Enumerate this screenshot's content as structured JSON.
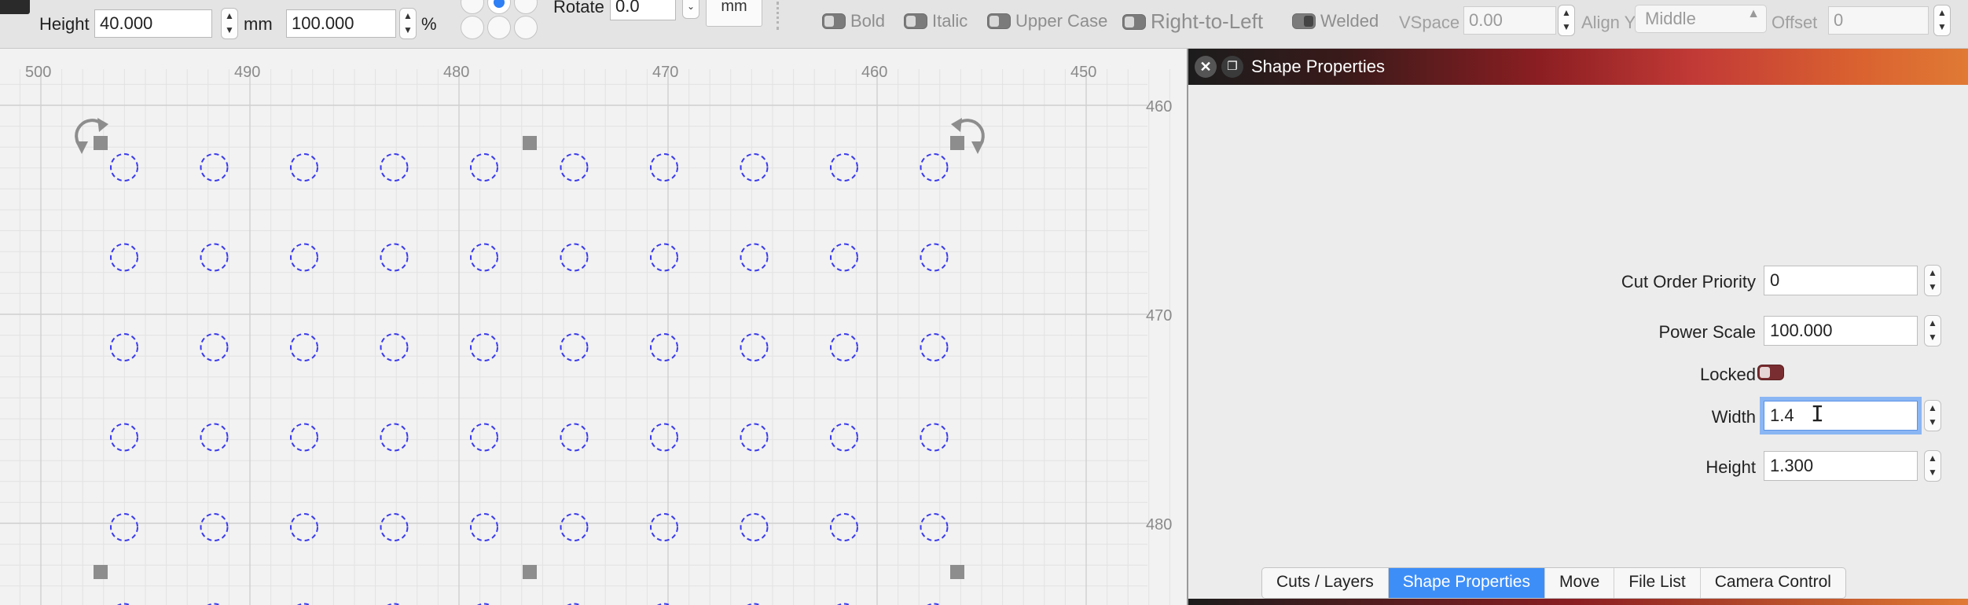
{
  "toolbar": {
    "height_label": "Height",
    "height_value": "40.000",
    "height_unit": "mm",
    "scale_value": "100.000",
    "scale_unit": "%",
    "rotate_label": "Rotate",
    "rotate_value": "0.0",
    "unit_button": "mm",
    "bold_label": "Bold",
    "italic_label": "Italic",
    "uppercase_label": "Upper Case",
    "rtl_label": "Right-to-Left",
    "welded_label": "Welded",
    "vspace_label": "VSpace",
    "vspace_value": "0.00",
    "aligny_label": "Align Y",
    "aligny_value": "Middle",
    "offset_label": "Offset",
    "offset_value": "0"
  },
  "canvas": {
    "ruler_x_labels": [
      "500",
      "490",
      "480",
      "470",
      "460",
      "450"
    ],
    "ruler_y_labels": [
      "460",
      "470",
      "480"
    ],
    "circle_rows": 6,
    "circle_cols": 10
  },
  "panel": {
    "title": "Shape Properties",
    "fields": {
      "cut_order_label": "Cut Order Priority",
      "cut_order_value": "0",
      "power_scale_label": "Power Scale",
      "power_scale_value": "100.000",
      "locked_label": "Locked",
      "width_label": "Width",
      "width_value": "1.4",
      "height_label": "Height",
      "height_value": "1.300"
    },
    "tabs": [
      "Cuts / Layers",
      "Shape Properties",
      "Move",
      "File List",
      "Camera Control"
    ]
  },
  "colors": {
    "accent": "#3e8ef7",
    "shape_stroke": "#3a3af0",
    "locked_toggle": "#7a2d30"
  }
}
